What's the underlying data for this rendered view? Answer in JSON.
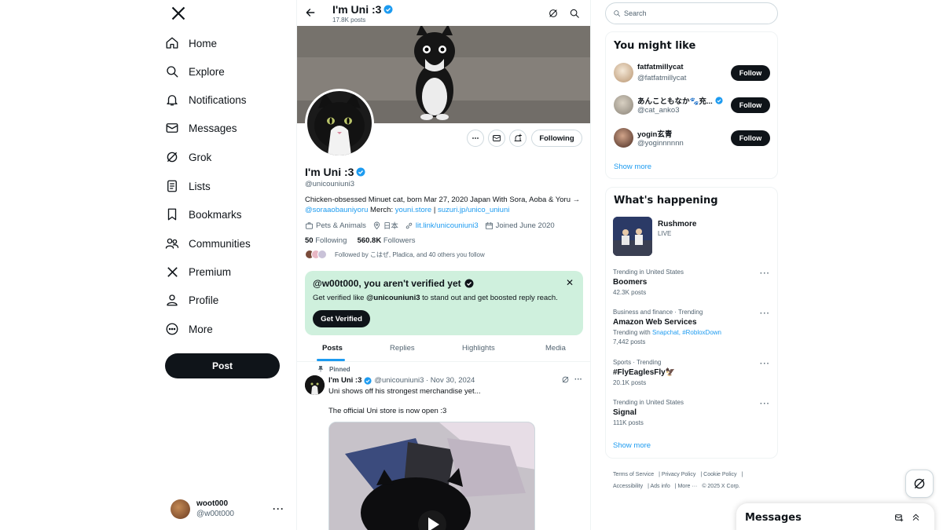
{
  "nav": {
    "items": [
      {
        "label": "Home",
        "icon": "home-icon"
      },
      {
        "label": "Explore",
        "icon": "search-icon"
      },
      {
        "label": "Notifications",
        "icon": "bell-icon"
      },
      {
        "label": "Messages",
        "icon": "envelope-icon"
      },
      {
        "label": "Grok",
        "icon": "grok-icon"
      },
      {
        "label": "Lists",
        "icon": "list-icon"
      },
      {
        "label": "Bookmarks",
        "icon": "bookmark-icon"
      },
      {
        "label": "Communities",
        "icon": "people-icon"
      },
      {
        "label": "Premium",
        "icon": "x-logo-icon"
      },
      {
        "label": "Profile",
        "icon": "person-icon"
      },
      {
        "label": "More",
        "icon": "more-circle-icon"
      }
    ],
    "post_label": "Post"
  },
  "account": {
    "name": "woot000",
    "handle": "@w00t000",
    "more": "···"
  },
  "topbar": {
    "name": "I'm Uni :3",
    "posts": "17.8K posts"
  },
  "profile": {
    "name": "I'm Uni :3",
    "handle": "@unicouniuni3",
    "following_label": "Following",
    "bio_text": "Chicken-obsessed Minuet cat, born Mar 27, 2020 Japan With Sora, Aoba & Yoru →",
    "bio_link1": "@soraaobauniyoru",
    "bio_merch": " Merch: ",
    "bio_link2": "youni.store",
    "bio_sep": " | ",
    "bio_link3": "suzuri.jp/unico_uniuni",
    "category": "Pets & Animals",
    "location": "日本",
    "website": "lit.link/unicouniuni3",
    "joined": "Joined June 2020",
    "following_count": "50",
    "following_word": "Following",
    "followers_count": "560.8K",
    "followers_word": "Followers",
    "followed_by": "Followed by こはぜ, Pladica, and 40 others you follow"
  },
  "verify": {
    "title": "@w00t000, you aren't verified yet",
    "text_pre": "Get verified like ",
    "text_handle": "@unicouniuni3",
    "text_post": " to stand out and get boosted reply reach.",
    "button": "Get Verified",
    "close": "✕"
  },
  "tabs": [
    "Posts",
    "Replies",
    "Highlights",
    "Media"
  ],
  "pinned_tweet": {
    "pinned_label": "Pinned",
    "name": "I'm Uni :3",
    "meta": "@unicouniuni3 · Nov 30, 2024",
    "text1": "Uni shows off his strongest merchandise yet...",
    "text2": "The official Uni store is now open :3",
    "more": "···"
  },
  "search": {
    "placeholder": "Search"
  },
  "who_to_follow": {
    "title": "You might like",
    "accounts": [
      {
        "name": "fatfatmillycat",
        "handle": "@fatfatmillycat",
        "button": "Follow",
        "verified": false
      },
      {
        "name": "あんこともなか🐾充...",
        "handle": "@cat_anko3",
        "button": "Follow",
        "verified": true
      },
      {
        "name": "yogin玄青",
        "handle": "@yoginnnnnn",
        "button": "Follow",
        "verified": false
      }
    ],
    "show_more": "Show more"
  },
  "happening": {
    "title": "What's happening",
    "live": {
      "name": "Rushmore",
      "status": "LIVE"
    },
    "trends": [
      {
        "context": "Trending in United States",
        "name": "Boomers",
        "count": "42.3K posts"
      },
      {
        "context": "Business and finance · Trending",
        "name": "Amazon Web Services",
        "with_label": "Trending with ",
        "with_tags": "Snapchat, #RobloxDown",
        "count": "7,442 posts"
      },
      {
        "context": "Sports · Trending",
        "name": "#FlyEaglesFly🦅",
        "count": "20.1K posts"
      },
      {
        "context": "Trending in United States",
        "name": "Signal",
        "count": "111K posts"
      }
    ],
    "show_more": "Show more"
  },
  "footer": {
    "links": [
      "Terms of Service",
      "Privacy Policy",
      "Cookie Policy",
      "Accessibility",
      "Ads info",
      "More ···"
    ],
    "copyright": "© 2025 X Corp."
  },
  "messages_drawer": {
    "title": "Messages"
  },
  "colors": {
    "accent": "#1d9bf0",
    "verify_bg": "#cff0dd",
    "text": "#0f1419",
    "muted": "#536471"
  }
}
